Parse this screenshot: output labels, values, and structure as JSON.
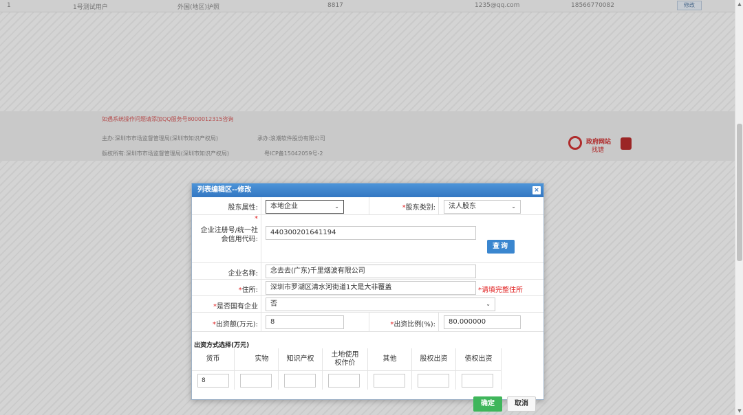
{
  "background": {
    "table_row": {
      "index": "1",
      "name": "1号测试用户",
      "id_type": "外国(地区)护照",
      "id_no": "8817",
      "email": "1235@qq.com",
      "phone": "18566770082",
      "edit_label": "修改"
    },
    "footer": {
      "notice": "如遇系统操作问题请添加QQ服务号800001231​5咨询",
      "sponsor": "主办:深圳市市场监督管理局(深圳市知识产权局)",
      "undertaker": "承办:浪潮软件股份有限公司",
      "copyright": "版权所有:深圳市市场监督管理局(深圳市知识产权局)",
      "icp": "粤ICP备15042059号-2",
      "gov_badge_line1": "政府网站",
      "gov_badge_line2": "找错"
    }
  },
  "dialog": {
    "title": "列表编辑区--修改",
    "close_icon": "×",
    "fields": {
      "shareholder_attr": {
        "label": "股东属性:",
        "value": "本地企业"
      },
      "shareholder_type": {
        "label": "股东类别:",
        "value": "法人股东"
      },
      "reg_code": {
        "label_line1": "企业注册号/统一社",
        "label_line2": "会信用代码:",
        "value": "440300201641194"
      },
      "query_button": "查询",
      "company_name": {
        "label": "企业名称:",
        "value": "念去去(广东)千里烟波有限公司"
      },
      "address": {
        "label": "住所:",
        "value": "深圳市罗湖区清水河街道1大是大非覆盖",
        "hint": "请填完整住所"
      },
      "state_owned": {
        "label": "是否国有企业",
        "value": "否"
      },
      "capital": {
        "label": "出资额(万元):",
        "value": "8"
      },
      "ratio": {
        "label": "出资比例(%):",
        "value": "80.000000"
      }
    },
    "contribution": {
      "title": "出资方式选择(万元)",
      "columns": [
        {
          "label": "货币",
          "value": "8"
        },
        {
          "label": "实物",
          "value": ""
        },
        {
          "label": "知识产权",
          "value": ""
        },
        {
          "label": "土地使用权作价",
          "value": ""
        },
        {
          "label": "其他",
          "value": ""
        },
        {
          "label": "股权出资",
          "value": ""
        },
        {
          "label": "债权出资",
          "value": ""
        }
      ]
    },
    "buttons": {
      "ok": "确定",
      "cancel": "取消"
    }
  }
}
